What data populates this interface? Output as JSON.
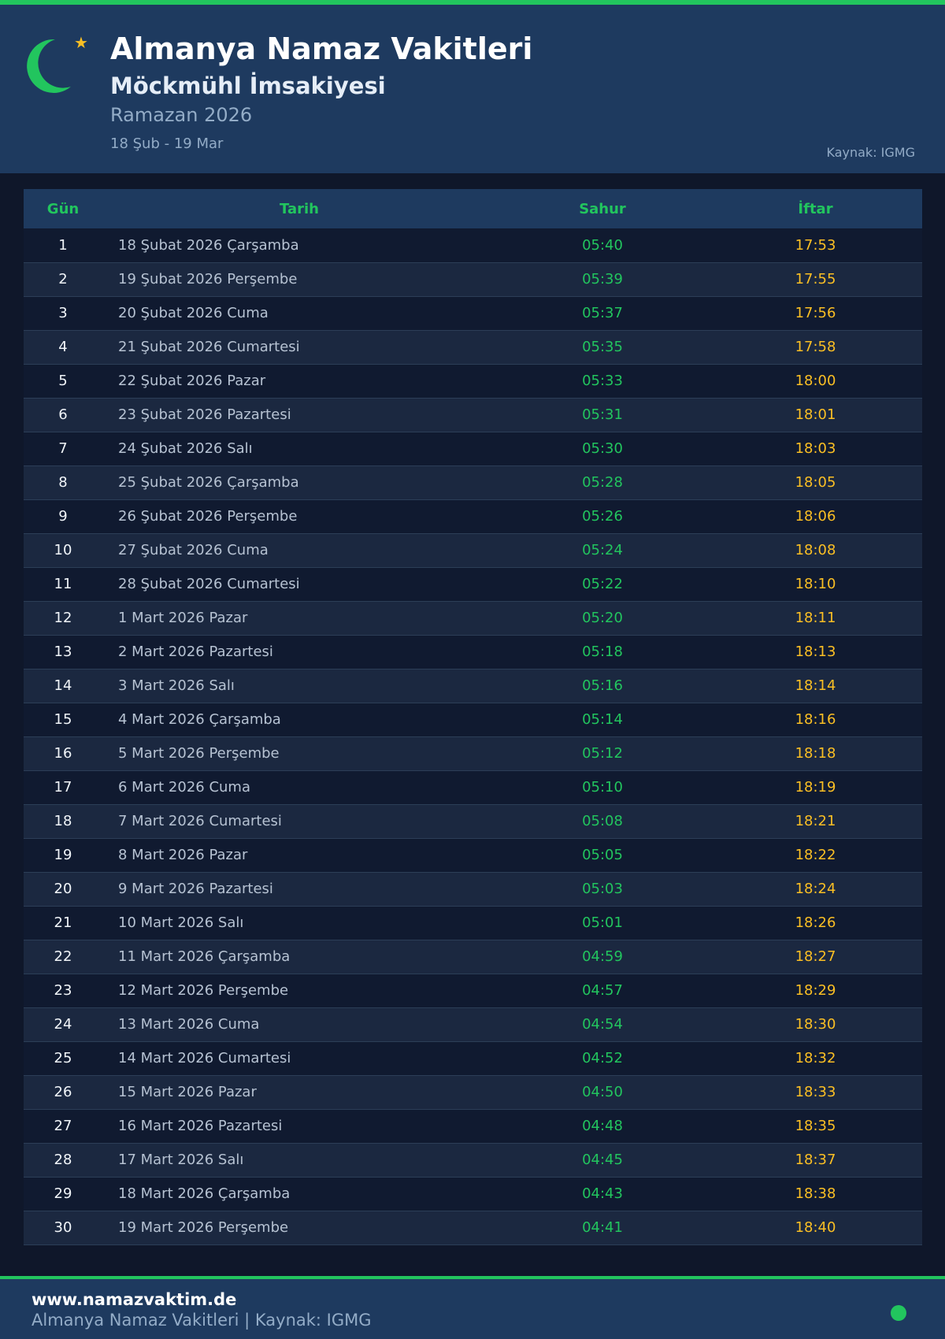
{
  "header": {
    "title": "Almanya Namaz Vakitleri",
    "subtitle": "Möckmühl İmsakiyesi",
    "period": "Ramazan 2026",
    "range": "18 Şub - 19 Mar",
    "source": "Kaynak: IGMG"
  },
  "icons": {
    "moon": "crescent-moon-icon",
    "star": "star-icon"
  },
  "colors": {
    "accent": "#22c55e",
    "iftar": "#fbbf24",
    "header_bg": "#1e3a5f",
    "page_bg": "#0f172a"
  },
  "table": {
    "columns": [
      "Gün",
      "Tarih",
      "Sahur",
      "İftar"
    ],
    "rows": [
      {
        "day": "1",
        "date": "18 Şubat 2026 Çarşamba",
        "sahur": "05:40",
        "iftar": "17:53"
      },
      {
        "day": "2",
        "date": "19 Şubat 2026 Perşembe",
        "sahur": "05:39",
        "iftar": "17:55"
      },
      {
        "day": "3",
        "date": "20 Şubat 2026 Cuma",
        "sahur": "05:37",
        "iftar": "17:56"
      },
      {
        "day": "4",
        "date": "21 Şubat 2026 Cumartesi",
        "sahur": "05:35",
        "iftar": "17:58"
      },
      {
        "day": "5",
        "date": "22 Şubat 2026 Pazar",
        "sahur": "05:33",
        "iftar": "18:00"
      },
      {
        "day": "6",
        "date": "23 Şubat 2026 Pazartesi",
        "sahur": "05:31",
        "iftar": "18:01"
      },
      {
        "day": "7",
        "date": "24 Şubat 2026 Salı",
        "sahur": "05:30",
        "iftar": "18:03"
      },
      {
        "day": "8",
        "date": "25 Şubat 2026 Çarşamba",
        "sahur": "05:28",
        "iftar": "18:05"
      },
      {
        "day": "9",
        "date": "26 Şubat 2026 Perşembe",
        "sahur": "05:26",
        "iftar": "18:06"
      },
      {
        "day": "10",
        "date": "27 Şubat 2026 Cuma",
        "sahur": "05:24",
        "iftar": "18:08"
      },
      {
        "day": "11",
        "date": "28 Şubat 2026 Cumartesi",
        "sahur": "05:22",
        "iftar": "18:10"
      },
      {
        "day": "12",
        "date": "1 Mart 2026 Pazar",
        "sahur": "05:20",
        "iftar": "18:11"
      },
      {
        "day": "13",
        "date": "2 Mart 2026 Pazartesi",
        "sahur": "05:18",
        "iftar": "18:13"
      },
      {
        "day": "14",
        "date": "3 Mart 2026 Salı",
        "sahur": "05:16",
        "iftar": "18:14"
      },
      {
        "day": "15",
        "date": "4 Mart 2026 Çarşamba",
        "sahur": "05:14",
        "iftar": "18:16"
      },
      {
        "day": "16",
        "date": "5 Mart 2026 Perşembe",
        "sahur": "05:12",
        "iftar": "18:18"
      },
      {
        "day": "17",
        "date": "6 Mart 2026 Cuma",
        "sahur": "05:10",
        "iftar": "18:19"
      },
      {
        "day": "18",
        "date": "7 Mart 2026 Cumartesi",
        "sahur": "05:08",
        "iftar": "18:21"
      },
      {
        "day": "19",
        "date": "8 Mart 2026 Pazar",
        "sahur": "05:05",
        "iftar": "18:22"
      },
      {
        "day": "20",
        "date": "9 Mart 2026 Pazartesi",
        "sahur": "05:03",
        "iftar": "18:24"
      },
      {
        "day": "21",
        "date": "10 Mart 2026 Salı",
        "sahur": "05:01",
        "iftar": "18:26"
      },
      {
        "day": "22",
        "date": "11 Mart 2026 Çarşamba",
        "sahur": "04:59",
        "iftar": "18:27"
      },
      {
        "day": "23",
        "date": "12 Mart 2026 Perşembe",
        "sahur": "04:57",
        "iftar": "18:29"
      },
      {
        "day": "24",
        "date": "13 Mart 2026 Cuma",
        "sahur": "04:54",
        "iftar": "18:30"
      },
      {
        "day": "25",
        "date": "14 Mart 2026 Cumartesi",
        "sahur": "04:52",
        "iftar": "18:32"
      },
      {
        "day": "26",
        "date": "15 Mart 2026 Pazar",
        "sahur": "04:50",
        "iftar": "18:33"
      },
      {
        "day": "27",
        "date": "16 Mart 2026 Pazartesi",
        "sahur": "04:48",
        "iftar": "18:35"
      },
      {
        "day": "28",
        "date": "17 Mart 2026 Salı",
        "sahur": "04:45",
        "iftar": "18:37"
      },
      {
        "day": "29",
        "date": "18 Mart 2026 Çarşamba",
        "sahur": "04:43",
        "iftar": "18:38"
      },
      {
        "day": "30",
        "date": "19 Mart 2026 Perşembe",
        "sahur": "04:41",
        "iftar": "18:40"
      }
    ]
  },
  "footer": {
    "site": "www.namazvaktim.de",
    "subtitle": "Almanya Namaz Vakitleri | Kaynak: IGMG"
  }
}
